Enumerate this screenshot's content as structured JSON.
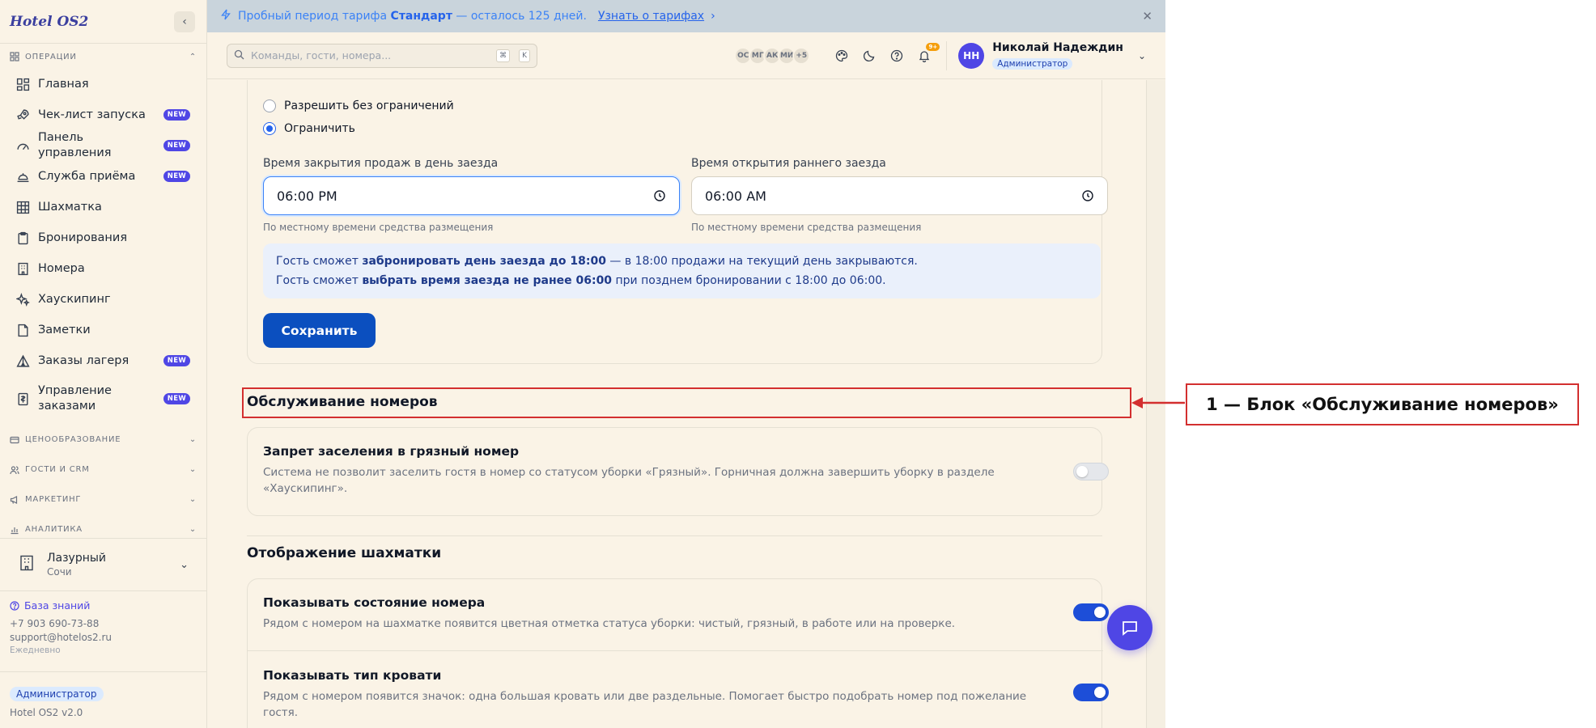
{
  "app": {
    "logo": "Hotel OS2"
  },
  "sidebar": {
    "sections": {
      "operations": "ОПЕРАЦИИ",
      "pricing": "ЦЕНООБРАЗОВАНИЕ",
      "guests": "ГОСТИ И CRM",
      "marketing": "МАРКЕТИНГ",
      "analytics": "АНАЛИТИКА"
    },
    "items": [
      {
        "label": "Главная",
        "icon": "grid-icon",
        "badge": ""
      },
      {
        "label": "Чек-лист запуска",
        "icon": "rocket-icon",
        "badge": "NEW"
      },
      {
        "label": "Панель управления",
        "icon": "gauge-icon",
        "badge": "NEW"
      },
      {
        "label": "Служба приёма",
        "icon": "bell-icon",
        "badge": "NEW"
      },
      {
        "label": "Шахматка",
        "icon": "table-icon",
        "badge": ""
      },
      {
        "label": "Бронирования",
        "icon": "clipboard-icon",
        "badge": ""
      },
      {
        "label": "Номера",
        "icon": "building-icon",
        "badge": ""
      },
      {
        "label": "Хаускипинг",
        "icon": "sparkles-icon",
        "badge": ""
      },
      {
        "label": "Заметки",
        "icon": "note-icon",
        "badge": ""
      },
      {
        "label": "Заказы лагеря",
        "icon": "tent-icon",
        "badge": "NEW"
      },
      {
        "label": "Управление заказами",
        "icon": "receipt-icon",
        "badge": "NEW"
      }
    ],
    "hotel": {
      "name": "Лазурный",
      "city": "Сочи"
    },
    "support": {
      "knowledge_base": "База знаний",
      "phone": "+7 903 690-73-88",
      "email": "support@hotelos2.ru",
      "schedule": "Ежедневно"
    },
    "footer": {
      "role": "Администратор",
      "version": "Hotel OS2 v2.0"
    }
  },
  "banner": {
    "prefix": "Пробный период тарифа",
    "plan": "Стандарт",
    "suffix": "— осталось 125 дней.",
    "link": "Узнать о тарифах"
  },
  "topbar": {
    "search_placeholder": "Команды, гости, номера...",
    "shortcut_keys": [
      "⌘",
      "K"
    ],
    "avatars": [
      "ОС",
      "МГ",
      "АК",
      "МИ",
      "+5"
    ],
    "notifications_count": "9+",
    "user": {
      "initials": "НН",
      "name": "Николай Надеждин",
      "role": "Администратор"
    }
  },
  "sales_limit": {
    "options": [
      "Разрешить без ограничений",
      "Ограничить"
    ],
    "selected": "Ограничить",
    "close_label": "Время закрытия продаж в день заезда",
    "close_value": "06:00 PM",
    "open_label": "Время открытия раннего заезда",
    "open_value": "06:00 AM",
    "hint": "По местному времени средства размещения",
    "info_line1_pre": "Гость сможет ",
    "info_line1_bold": "забронировать день заезда до 18:00",
    "info_line1_post": " — в 18:00 продажи на текущий день закрываются.",
    "info_line2_pre": "Гость сможет ",
    "info_line2_bold": "выбрать время заезда не ранее 06:00",
    "info_line2_post": " при позднем бронировании с 18:00 до 06:00.",
    "save_button": "Сохранить"
  },
  "room_service": {
    "title": "Обслуживание номеров",
    "options": [
      {
        "title": "Запрет заселения в грязный номер",
        "description": "Система не позволит заселить гостя в номер со статусом уборки «Грязный». Горничная должна завершить уборку в разделе «Хаускипинг».",
        "enabled": false
      }
    ]
  },
  "chessboard": {
    "title": "Отображение шахматки",
    "options": [
      {
        "title": "Показывать состояние номера",
        "description": "Рядом с номером на шахматке появится цветная отметка статуса уборки: чистый, грязный, в работе или на проверке.",
        "enabled": true
      },
      {
        "title": "Показывать тип кровати",
        "description": "Рядом с номером появится значок: одна большая кровать или две раздельные. Помогает быстро подобрать номер под пожелание гостя.",
        "enabled": true
      }
    ]
  },
  "annotation": {
    "label": "1 — Блок «Обслуживание номеров»"
  },
  "colors": {
    "accent": "#4f46e5",
    "primary_button": "#0b4fbf",
    "annotation": "#d32f2f",
    "background": "#faf3e6"
  }
}
